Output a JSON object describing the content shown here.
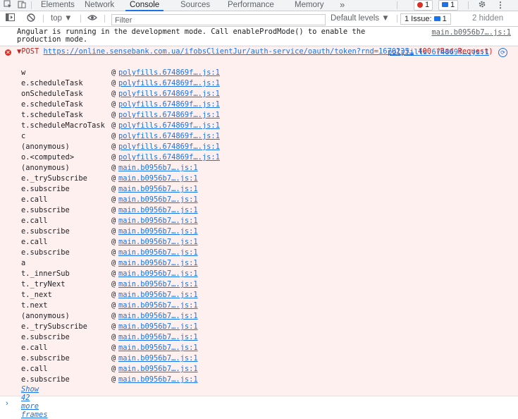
{
  "tabbar": {
    "inspect_icon": "cursor-select-icon",
    "device_icon": "device-toolbar-icon",
    "tabs": [
      "Elements",
      "Network",
      "Console",
      "Sources",
      "Performance",
      "Memory"
    ],
    "more": "»",
    "error_count": "1",
    "message_count": "1",
    "settings_icon": "gear-icon",
    "menu_icon": "⋮"
  },
  "toolbar": {
    "context": "top ▼",
    "filter_placeholder": "Filter",
    "levels": "Default levels ▼",
    "issues": "1 Issue:",
    "issues_count": "1",
    "hidden": "2 hidden"
  },
  "info": {
    "message": "Angular is running in the development mode. Call enableProdMode() to enable the production mode.",
    "source": "main.b0956b7….js:1"
  },
  "error": {
    "method": "▼POST",
    "url": "https://online.sensebank.com.ua/ifobsClientJur/auth-service/oauth/token?rnd=1670235…",
    "status": "400 (Bad Request)",
    "source": "polyfills.674869f….js:1"
  },
  "stack": [
    {
      "fn": "w",
      "loc": "polyfills.674869f….js:1"
    },
    {
      "fn": "e.scheduleTask",
      "loc": "polyfills.674869f….js:1"
    },
    {
      "fn": "onScheduleTask",
      "loc": "polyfills.674869f….js:1"
    },
    {
      "fn": "e.scheduleTask",
      "loc": "polyfills.674869f….js:1"
    },
    {
      "fn": "t.scheduleTask",
      "loc": "polyfills.674869f….js:1"
    },
    {
      "fn": "t.scheduleMacroTask",
      "loc": "polyfills.674869f….js:1"
    },
    {
      "fn": "c",
      "loc": "polyfills.674869f….js:1"
    },
    {
      "fn": "(anonymous)",
      "loc": "polyfills.674869f….js:1"
    },
    {
      "fn": "o.<computed>",
      "loc": "polyfills.674869f….js:1"
    },
    {
      "fn": "(anonymous)",
      "loc": "main.b0956b7….js:1"
    },
    {
      "fn": "e._trySubscribe",
      "loc": "main.b0956b7….js:1"
    },
    {
      "fn": "e.subscribe",
      "loc": "main.b0956b7….js:1"
    },
    {
      "fn": "e.call",
      "loc": "main.b0956b7….js:1"
    },
    {
      "fn": "e.subscribe",
      "loc": "main.b0956b7….js:1"
    },
    {
      "fn": "e.call",
      "loc": "main.b0956b7….js:1"
    },
    {
      "fn": "e.subscribe",
      "loc": "main.b0956b7….js:1"
    },
    {
      "fn": "e.call",
      "loc": "main.b0956b7….js:1"
    },
    {
      "fn": "e.subscribe",
      "loc": "main.b0956b7….js:1"
    },
    {
      "fn": "a",
      "loc": "main.b0956b7….js:1"
    },
    {
      "fn": "t._innerSub",
      "loc": "main.b0956b7….js:1"
    },
    {
      "fn": "t._tryNext",
      "loc": "main.b0956b7….js:1"
    },
    {
      "fn": "t._next",
      "loc": "main.b0956b7….js:1"
    },
    {
      "fn": "t.next",
      "loc": "main.b0956b7….js:1"
    },
    {
      "fn": "(anonymous)",
      "loc": "main.b0956b7….js:1"
    },
    {
      "fn": "e._trySubscribe",
      "loc": "main.b0956b7….js:1"
    },
    {
      "fn": "e.subscribe",
      "loc": "main.b0956b7….js:1"
    },
    {
      "fn": "e.call",
      "loc": "main.b0956b7….js:1"
    },
    {
      "fn": "e.subscribe",
      "loc": "main.b0956b7….js:1"
    },
    {
      "fn": "e.call",
      "loc": "main.b0956b7….js:1"
    },
    {
      "fn": "e.subscribe",
      "loc": "main.b0956b7….js:1"
    }
  ],
  "show_more": "Show 42 more frames",
  "prompt": "›",
  "colors": {
    "error_bg": "#fff0f0",
    "link": "#1a73e8",
    "error_text": "#c5221f",
    "accent": "#1a73e8"
  }
}
